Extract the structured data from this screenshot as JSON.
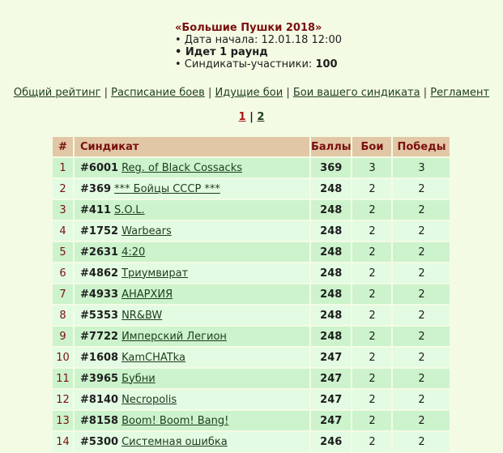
{
  "tournament": {
    "title": "«Большие Пушки 2018»",
    "start_label": "• Дата начала: 12.01.18 12:00",
    "round_label": "• Идет 1 раунд",
    "participants_label": "• Синдикаты-участники: ",
    "participants_value": "100"
  },
  "nav": {
    "links": [
      "Общий рейтинг",
      "Расписание боев",
      "Идущие бои",
      "Бои вашего синдиката",
      "Регламент"
    ],
    "separator": "|"
  },
  "pagination": {
    "current": "1",
    "separator": "|",
    "other": "2"
  },
  "table": {
    "headers": {
      "num": "#",
      "syndicate": "Синдикат",
      "score": "Баллы",
      "fights": "Бои",
      "wins": "Победы"
    },
    "rows": [
      {
        "num": "1",
        "id": "#6001",
        "name": "Reg. of Black Cossacks",
        "score": "369",
        "fights": "3",
        "wins": "3"
      },
      {
        "num": "2",
        "id": "#369",
        "name": "*** Бойцы СССР ***",
        "score": "248",
        "fights": "2",
        "wins": "2"
      },
      {
        "num": "3",
        "id": "#411",
        "name": "S.O.L.",
        "score": "248",
        "fights": "2",
        "wins": "2"
      },
      {
        "num": "4",
        "id": "#1752",
        "name": "Warbears",
        "score": "248",
        "fights": "2",
        "wins": "2"
      },
      {
        "num": "5",
        "id": "#2631",
        "name": "4:20",
        "score": "248",
        "fights": "2",
        "wins": "2"
      },
      {
        "num": "6",
        "id": "#4862",
        "name": "Триумвират",
        "score": "248",
        "fights": "2",
        "wins": "2"
      },
      {
        "num": "7",
        "id": "#4933",
        "name": "АНАРХИЯ",
        "score": "248",
        "fights": "2",
        "wins": "2"
      },
      {
        "num": "8",
        "id": "#5353",
        "name": "NR&BW",
        "score": "248",
        "fights": "2",
        "wins": "2"
      },
      {
        "num": "9",
        "id": "#7722",
        "name": "Имперский Легион",
        "score": "248",
        "fights": "2",
        "wins": "2"
      },
      {
        "num": "10",
        "id": "#1608",
        "name": "KamCHATka",
        "score": "247",
        "fights": "2",
        "wins": "2"
      },
      {
        "num": "11",
        "id": "#3965",
        "name": "Бубни",
        "score": "247",
        "fights": "2",
        "wins": "2"
      },
      {
        "num": "12",
        "id": "#8140",
        "name": "Necropolis",
        "score": "247",
        "fights": "2",
        "wins": "2"
      },
      {
        "num": "13",
        "id": "#8158",
        "name": "Boom! Boom! Bang!",
        "score": "247",
        "fights": "2",
        "wins": "2"
      },
      {
        "num": "14",
        "id": "#5300",
        "name": "Системная ошибка",
        "score": "246",
        "fights": "2",
        "wins": "2"
      }
    ]
  }
}
